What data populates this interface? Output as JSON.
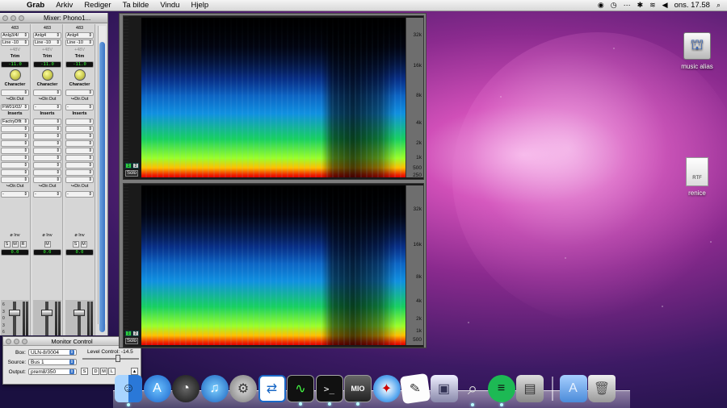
{
  "menubar": {
    "app": "Grab",
    "items": [
      "Arkiv",
      "Rediger",
      "Ta bilde",
      "Vindu",
      "Hjelp"
    ],
    "clock": "ons. 17.58"
  },
  "mixer": {
    "title": "Mixer: Phono1...",
    "strips": [
      {
        "id": "483",
        "in": "Anlg3/4/",
        "line": "Line -10",
        "phantom": "+48V",
        "trim_label": "Trim",
        "trim": "-11.0",
        "char": "Character",
        "out": "↪Dir.Out",
        "out_sel": "FW01/02/",
        "inserts": "Inserts",
        "insert1": "FactryDflt",
        "out2": "↪Dir.Out",
        "inv": "ø Inv",
        "s": "S",
        "m": "M",
        "r": "R",
        "level": "0.0"
      },
      {
        "id": "483",
        "in": "Anlg4",
        "line": "Line -10",
        "phantom": "+48V",
        "trim_label": "Trim",
        "trim": "-11.0",
        "char": "Character",
        "out": "↪Dir.Out",
        "out_sel": "-",
        "inserts": "Inserts",
        "insert1": "",
        "out2": "↪Dir.Out",
        "inv": "ø Inv",
        "s": "",
        "m": "M",
        "r": "",
        "level": "0.0"
      },
      {
        "id": "483",
        "in": "Anlg4",
        "line": "Line -10",
        "phantom": "+48V",
        "trim_label": "Trim",
        "trim": "-11.0",
        "char": "Character",
        "out": "↪Dir.Out",
        "out_sel": "-",
        "inserts": "Inserts",
        "insert1": "",
        "out2": "↪Dir.Out",
        "inv": "ø Inv",
        "s": "S",
        "m": "M",
        "r": "",
        "level": "0.0"
      }
    ],
    "scale": [
      "6",
      "3",
      "0",
      "3",
      "6",
      "12",
      "18",
      "24"
    ]
  },
  "monitor": {
    "title": "Monitor Control",
    "box_label": "Box:",
    "box_value": "ULN-8/0004",
    "source_label": "Source:",
    "source_value": "Bus 1",
    "output_label": "Output:",
    "output_value": "prem8/350",
    "level_label": "Level Control:",
    "level_value": "-14.5",
    "btn_s": "S",
    "btn_d": "D",
    "btn_m": "M",
    "btn_l": "L"
  },
  "spectrum": {
    "top_ticks": [
      "32k",
      "16k",
      "8k",
      "4k",
      "2k",
      "1k",
      "500",
      "250"
    ],
    "bottom_ticks": [
      "32k",
      "16k",
      "8k",
      "4k",
      "2k",
      "1k",
      "500"
    ],
    "solo": "Solo"
  },
  "desktop": {
    "icons": [
      {
        "label": "music alias"
      },
      {
        "label": "renice",
        "badge": "RTF"
      }
    ]
  },
  "dock": {
    "mio_label": "MIO"
  },
  "colors": {
    "accent": "#3a74c6",
    "meter_green": "#33ff33"
  }
}
